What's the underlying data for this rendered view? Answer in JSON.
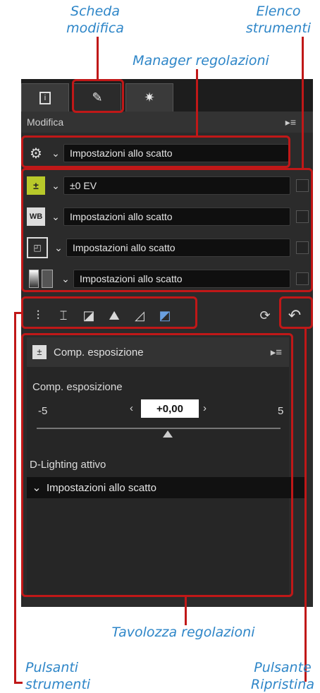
{
  "callouts": {
    "tab_edit_line1": "Scheda",
    "tab_edit_line2": "modifica",
    "tools_list_line1": "Elenco",
    "tools_list_line2": "strumenti",
    "adjust_manager": "Manager regolazioni",
    "adjust_palette": "Tavolozza regolazioni",
    "tool_buttons_line1": "Pulsanti",
    "tool_buttons_line2": "strumenti",
    "reset_button_line1": "Pulsante",
    "reset_button_line2": "Ripristina"
  },
  "panel": {
    "title": "Modifica",
    "tabs": [
      "info-tab",
      "edit-tab",
      "effects-tab"
    ],
    "manager_value": "Impostazioni allo scatto",
    "tools": [
      {
        "icon": "exposure-icon",
        "value": "±0 EV"
      },
      {
        "icon": "wb-icon",
        "value": "Impostazioni allo scatto"
      },
      {
        "icon": "picture-control-icon",
        "value": "Impostazioni allo scatto"
      },
      {
        "icon": "tone-icon",
        "value": "Impostazioni allo scatto"
      }
    ]
  },
  "subpanel": {
    "title": "Comp. esposizione",
    "slider_label": "Comp. esposizione",
    "slider_value": "+0,00",
    "slider_min": "-5",
    "slider_max": "5",
    "d_lighting_label": "D-Lighting attivo",
    "d_lighting_value": "Impostazioni allo scatto"
  },
  "colors": {
    "accent": "#2e86c8",
    "highlight": "#c01818"
  }
}
